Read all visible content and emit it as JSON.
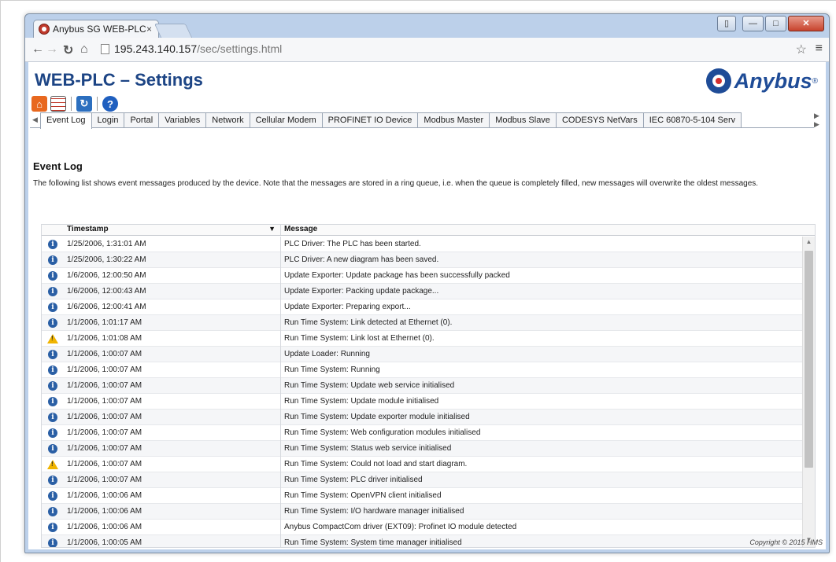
{
  "browser": {
    "tab_title": "Anybus SG WEB-PLC",
    "tab_close": "×",
    "url_host": "195.243.140.157",
    "url_path": "/sec/settings.html"
  },
  "page": {
    "title": "WEB-PLC – Settings",
    "brand": "Anybus",
    "brand_mark": "®",
    "copyright": "Copyright © 2015 HMS"
  },
  "tabs": [
    {
      "label": "Event Log"
    },
    {
      "label": "Login"
    },
    {
      "label": "Portal"
    },
    {
      "label": "Variables"
    },
    {
      "label": "Network"
    },
    {
      "label": "Cellular Modem"
    },
    {
      "label": "PROFINET IO Device"
    },
    {
      "label": "Modbus Master"
    },
    {
      "label": "Modbus Slave"
    },
    {
      "label": "CODESYS NetVars"
    },
    {
      "label": "IEC 60870-5-104 Serv"
    }
  ],
  "event_log": {
    "title": "Event Log",
    "intro": "The following list shows event messages produced by the device. Note that the messages are stored in a ring queue, i.e. when the queue is completely filled, new messages will overwrite the oldest messages.",
    "col_timestamp": "Timestamp",
    "col_message": "Message",
    "rows": [
      {
        "severity": "info",
        "ts": "1/25/2006, 1:31:01 AM",
        "msg": "PLC Driver: The PLC has been started."
      },
      {
        "severity": "info",
        "ts": "1/25/2006, 1:30:22 AM",
        "msg": "PLC Driver: A new diagram has been saved."
      },
      {
        "severity": "info",
        "ts": "1/6/2006, 12:00:50 AM",
        "msg": "Update Exporter: Update package has been successfully packed"
      },
      {
        "severity": "info",
        "ts": "1/6/2006, 12:00:43 AM",
        "msg": "Update Exporter: Packing update package..."
      },
      {
        "severity": "info",
        "ts": "1/6/2006, 12:00:41 AM",
        "msg": "Update Exporter: Preparing export..."
      },
      {
        "severity": "info",
        "ts": "1/1/2006, 1:01:17 AM",
        "msg": "Run Time System: Link detected at Ethernet (0)."
      },
      {
        "severity": "warning",
        "ts": "1/1/2006, 1:01:08 AM",
        "msg": "Run Time System: Link lost at Ethernet (0)."
      },
      {
        "severity": "info",
        "ts": "1/1/2006, 1:00:07 AM",
        "msg": "Update Loader: Running"
      },
      {
        "severity": "info",
        "ts": "1/1/2006, 1:00:07 AM",
        "msg": "Run Time System: Running"
      },
      {
        "severity": "info",
        "ts": "1/1/2006, 1:00:07 AM",
        "msg": "Run Time System: Update web service initialised"
      },
      {
        "severity": "info",
        "ts": "1/1/2006, 1:00:07 AM",
        "msg": "Run Time System: Update module initialised"
      },
      {
        "severity": "info",
        "ts": "1/1/2006, 1:00:07 AM",
        "msg": "Run Time System: Update exporter module initialised"
      },
      {
        "severity": "info",
        "ts": "1/1/2006, 1:00:07 AM",
        "msg": "Run Time System: Web configuration modules initialised"
      },
      {
        "severity": "info",
        "ts": "1/1/2006, 1:00:07 AM",
        "msg": "Run Time System: Status web service initialised"
      },
      {
        "severity": "warning",
        "ts": "1/1/2006, 1:00:07 AM",
        "msg": "Run Time System: Could not load and start diagram."
      },
      {
        "severity": "info",
        "ts": "1/1/2006, 1:00:07 AM",
        "msg": "Run Time System: PLC driver initialised"
      },
      {
        "severity": "info",
        "ts": "1/1/2006, 1:00:06 AM",
        "msg": "Run Time System: OpenVPN client initialised"
      },
      {
        "severity": "info",
        "ts": "1/1/2006, 1:00:06 AM",
        "msg": "Run Time System: I/O hardware manager initialised"
      },
      {
        "severity": "info",
        "ts": "1/1/2006, 1:00:06 AM",
        "msg": "Anybus CompactCom driver (EXT09): Profinet IO module detected"
      },
      {
        "severity": "info",
        "ts": "1/1/2006, 1:00:05 AM",
        "msg": "Run Time System: System time manager initialised"
      }
    ]
  }
}
